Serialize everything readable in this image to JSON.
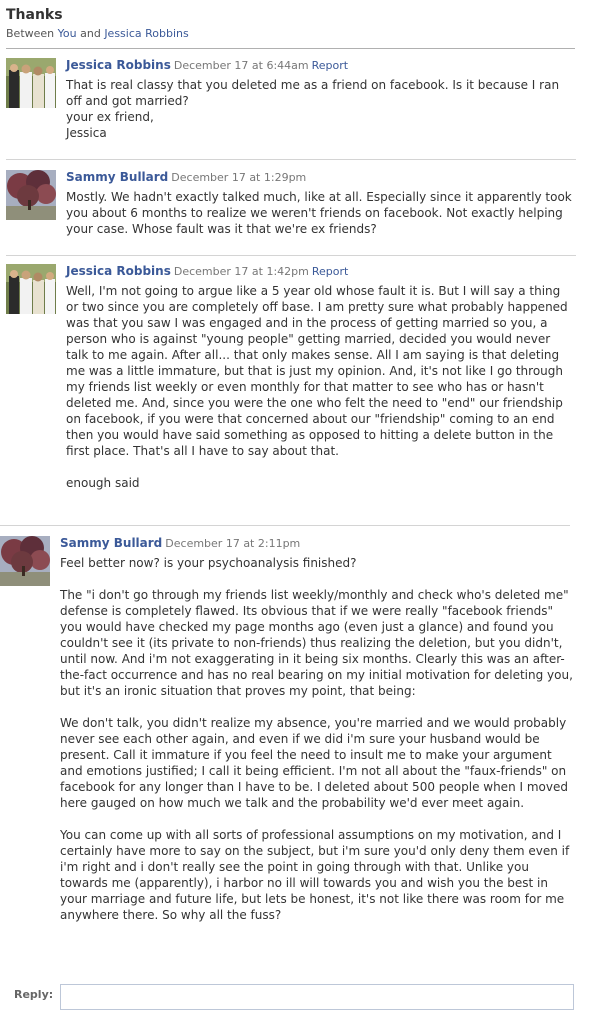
{
  "thread": {
    "title": "Thanks",
    "between_label": "Between",
    "participant_1": "You",
    "and_label": "and",
    "participant_2": "Jessica Robbins"
  },
  "messages": [
    {
      "author": "Jessica Robbins",
      "timestamp": "December 17 at 6:44am",
      "report_label": "Report",
      "avatar": "wedding-photo-avatar",
      "text": "That is real classy that you deleted me as a friend on facebook. Is it because I ran off and got married?\nyour ex friend,\nJessica"
    },
    {
      "author": "Sammy Bullard",
      "timestamp": "December 17 at 1:29pm",
      "avatar": "tree-photo-avatar",
      "text": "Mostly. We hadn't exactly talked much, like at all. Especially since it apparently took you about 6 months to realize we weren't friends on facebook. Not exactly helping your case. Whose fault was it that we're ex friends?"
    },
    {
      "author": "Jessica Robbins",
      "timestamp": "December 17 at 1:42pm",
      "report_label": "Report",
      "avatar": "wedding-photo-avatar",
      "text": "Well, I'm not going to argue like a 5 year old whose fault it is. But I will say a thing or two since you are completely off base. I am pretty sure what probably happened was that you saw I was engaged and in the process of getting married so you, a person who is against \"young people\" getting married, decided you would never talk to me again. After all... that only makes sense. All I am saying is that deleting me was a little immature, but that is just my opinion. And, it's not like I go through my friends list weekly or even monthly for that matter to see who has or hasn't deleted me. And, since you were the one who felt the need to \"end\" our friendship on facebook, if you were that concerned about our \"friendship\" coming to an end then you would have said something as opposed to hitting a delete button in the first place. That's all I have to say about that.\n\nenough said"
    },
    {
      "author": "Sammy Bullard",
      "timestamp": "December 17 at 2:11pm",
      "avatar": "tree-photo-avatar",
      "text": "Feel better now? is your psychoanalysis finished?\n\nThe \"i don't go through my friends list weekly/monthly and check who's deleted me\" defense is completely flawed. Its obvious that if we were really \"facebook friends\" you would have checked my page months ago (even just a glance) and found you couldn't see it (its private to non-friends) thus realizing the deletion, but you didn't, until now. And i'm not exaggerating in it being six months. Clearly this was an after-the-fact occurrence and has no real bearing on my initial motivation for deleting you, but it's an ironic situation that proves my point, that being:\n\nWe don't talk, you didn't realize my absence, you're married and we would probably never see each other again, and even if we did i'm sure your husband would be present. Call it immature if you feel the need to insult me to make your argument and emotions justified; I call it being efficient. I'm not all about the \"faux-friends\" on facebook for any longer than I have to be. I deleted about 500 people when I moved here gauged on how much we talk and the probability we'd ever meet again.\n\nYou can come up with all sorts of professional assumptions on my motivation, and I certainly have more to say on the subject, but i'm sure you'd only deny them even if i'm right and i don't really see the point in going through with that. Unlike you towards me (apparently), i harbor no ill will towards you and wish you the best in your marriage and future life, but lets be honest, it's not like there was room for me anywhere there. So why all the fuss?"
    }
  ],
  "reply": {
    "label": "Reply:",
    "value": ""
  },
  "colors": {
    "link": "#3b5998",
    "text": "#333333",
    "meta": "#777777",
    "separator": "#d4d4d4"
  }
}
